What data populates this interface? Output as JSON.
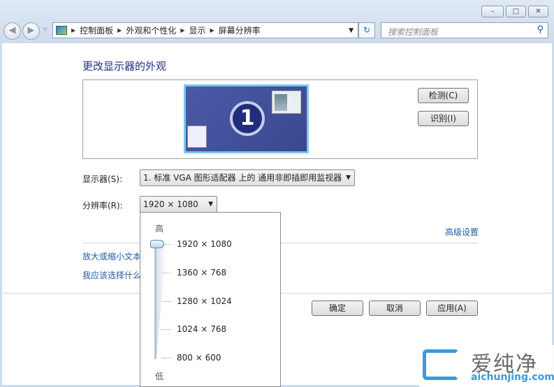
{
  "window": {
    "minimize": "–",
    "maximize": "□",
    "close": "✕"
  },
  "nav": {
    "back": "◀",
    "forward": "▶",
    "history": "▿"
  },
  "address": {
    "crumbs": [
      "控制面板",
      "外观和个性化",
      "显示",
      "屏幕分辨率"
    ],
    "refresh": "↻"
  },
  "search": {
    "placeholder": "搜索控制面板"
  },
  "main": {
    "title": "更改显示器的外观",
    "monitor_number": "1",
    "detect_button": "检测(C)",
    "identify_button": "识别(I)",
    "display_label": "显示器(S):",
    "display_value": "1. 标准 VGA 图形适配器 上的 通用非即插即用监视器",
    "resolution_label": "分辨率(R):",
    "resolution_value": "1920 × 1080",
    "advanced_link": "高级设置",
    "links": [
      "放大或缩小文本",
      "我应该选择什么"
    ],
    "ok_button": "确定",
    "cancel_button": "取消",
    "apply_button": "应用(A)"
  },
  "popup": {
    "high": "高",
    "low": "低",
    "options": [
      "1920 × 1080",
      "1360 × 768",
      "1280 × 1024",
      "1024 × 768",
      "800 × 600"
    ],
    "selected_index": 0
  },
  "watermark": {
    "text": "爱纯净",
    "url": "aichunjing.com"
  },
  "colors": {
    "title": "#1e3287",
    "link": "#1e5aa8",
    "desktop": "#3f4f9a"
  }
}
